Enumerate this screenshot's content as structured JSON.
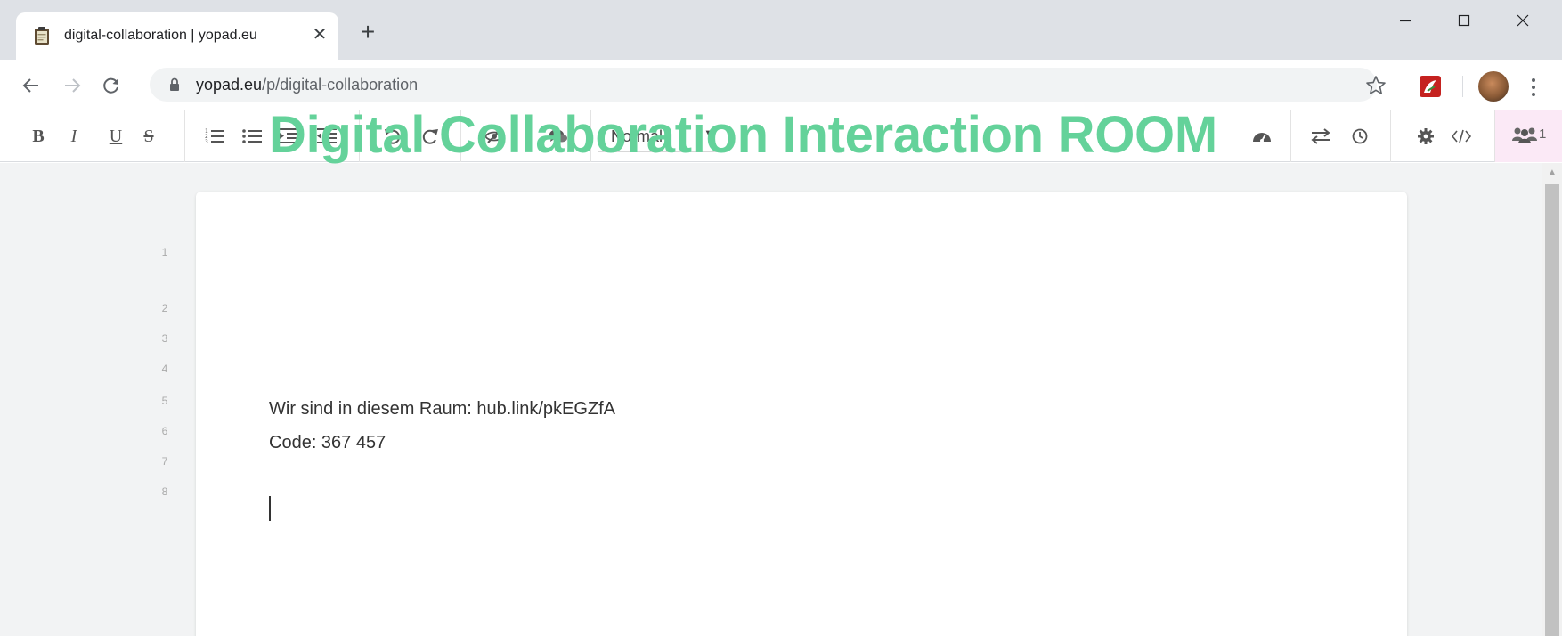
{
  "browser": {
    "tab": {
      "title": "digital-collaboration | yopad.eu",
      "close_glyph": "✕",
      "favicon": "clipboard-icon"
    },
    "new_tab_glyph": "+",
    "window_controls": [
      "minimize-icon",
      "maximize-icon",
      "close-icon"
    ],
    "address": {
      "domain": "yopad.eu",
      "path": "/p/digital-collaboration",
      "secure": true
    },
    "colors": {
      "tabstrip": "#dee1e6",
      "omnibox": "#f1f3f4"
    }
  },
  "toolbar": {
    "format_buttons": [
      {
        "name": "bold",
        "glyph": "B"
      },
      {
        "name": "italic",
        "glyph": "I"
      },
      {
        "name": "underline",
        "glyph": "U"
      },
      {
        "name": "strikethrough",
        "glyph": "S"
      }
    ],
    "heading_select": {
      "value": "Normal",
      "caret": "▼"
    },
    "users_count": "1",
    "colors": {
      "users_highlight": "#fbe9f6"
    }
  },
  "document": {
    "line_numbers": [
      "1",
      "2",
      "3",
      "4",
      "5",
      "6",
      "7",
      "8"
    ],
    "heading": "Digital Collaboration Interaction ROOM",
    "lines": {
      "room": "Wir sind in diesem Raum: hub.link/pkEGZfA",
      "code": "Code: 367 457"
    },
    "colors": {
      "heading": "#64d29a",
      "background": "#f2f3f4"
    }
  }
}
